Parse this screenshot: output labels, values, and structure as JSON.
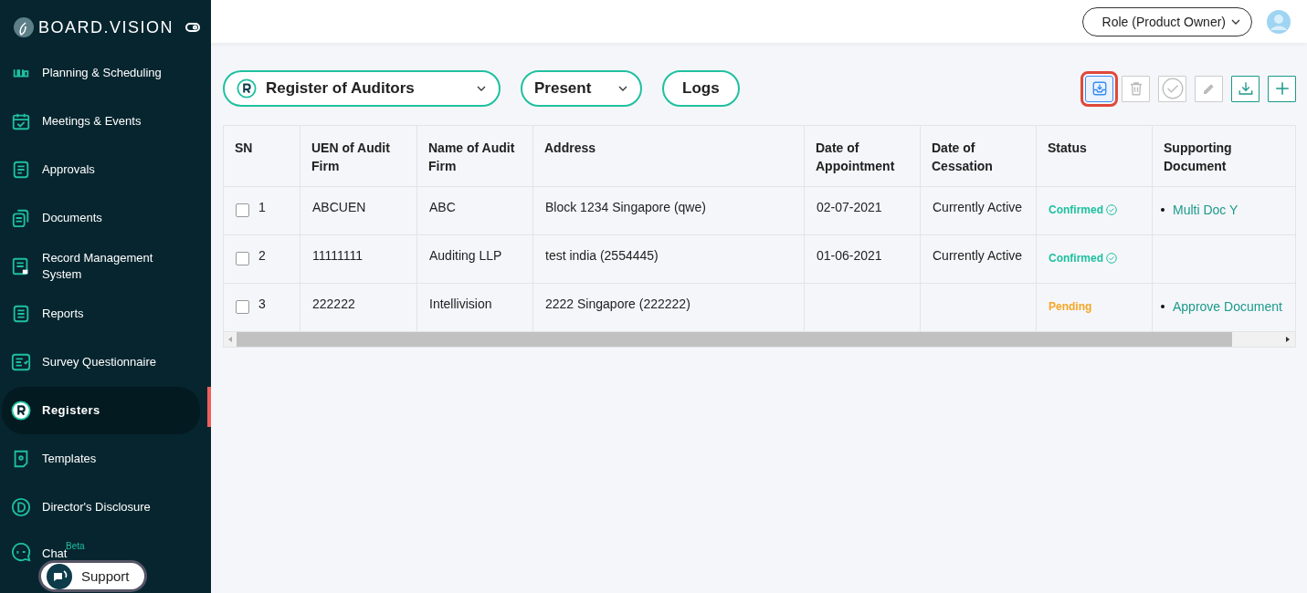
{
  "sidebar": {
    "brand": "BOARD.VISION",
    "items": [
      {
        "label": "Planning & Scheduling",
        "selected": false
      },
      {
        "label": "Meetings & Events",
        "selected": false
      },
      {
        "label": "Approvals",
        "selected": false
      },
      {
        "label": "Documents",
        "selected": false
      },
      {
        "label": "Record Management System",
        "selected": false
      },
      {
        "label": "Reports",
        "selected": false
      },
      {
        "label": "Survey Questionnaire",
        "selected": false
      },
      {
        "label": "Registers",
        "selected": true
      },
      {
        "label": "Templates",
        "selected": false
      },
      {
        "label": "Director's Disclosure",
        "selected": false
      },
      {
        "label": "Chat",
        "selected": false,
        "badge": "Beta"
      }
    ],
    "support": "Support"
  },
  "header": {
    "role": "Role (Product Owner)"
  },
  "filters": {
    "register": "Register of Auditors",
    "period": "Present",
    "logs": "Logs"
  },
  "toolbar": [
    {
      "kind": "import",
      "disabled": false,
      "highlighted": true
    },
    {
      "kind": "delete",
      "disabled": true,
      "highlighted": false
    },
    {
      "kind": "approve",
      "disabled": true,
      "highlighted": false
    },
    {
      "kind": "edit",
      "disabled": true,
      "highlighted": false
    },
    {
      "kind": "download",
      "disabled": false,
      "highlighted": false
    },
    {
      "kind": "add",
      "disabled": false,
      "highlighted": false
    }
  ],
  "table": {
    "columns": [
      "SN",
      "UEN of Audit Firm",
      "Name of Audit Firm",
      "Address",
      "Date of Appointment",
      "Date of Cessation",
      "Status",
      "Supporting Document"
    ],
    "rows": [
      {
        "checked": false,
        "sn": "1",
        "uen": "ABCUEN",
        "name": "ABC",
        "address": "Block 1234 Singapore (qwe)",
        "appointment": "02-07-2021",
        "cessation": "Currently Active",
        "status": "Confirmed",
        "color": "#1fc0a0",
        "verified": true,
        "documents": [
          "Multi Doc Y"
        ]
      },
      {
        "checked": false,
        "sn": "2",
        "uen": "11111111",
        "name": "Auditing LLP",
        "address": "test india (2554445)",
        "appointment": "01-06-2021",
        "cessation": "Currently Active",
        "status": "Confirmed",
        "color": "#1fc0a0",
        "verified": true,
        "documents": []
      },
      {
        "checked": false,
        "sn": "3",
        "uen": "222222",
        "name": "Intellivision",
        "address": "2222 Singapore (222222)",
        "appointment": "",
        "cessation": "",
        "status": "Pending",
        "color": "#f5a623",
        "verified": false,
        "documents": [
          "Approve Document"
        ]
      }
    ]
  }
}
